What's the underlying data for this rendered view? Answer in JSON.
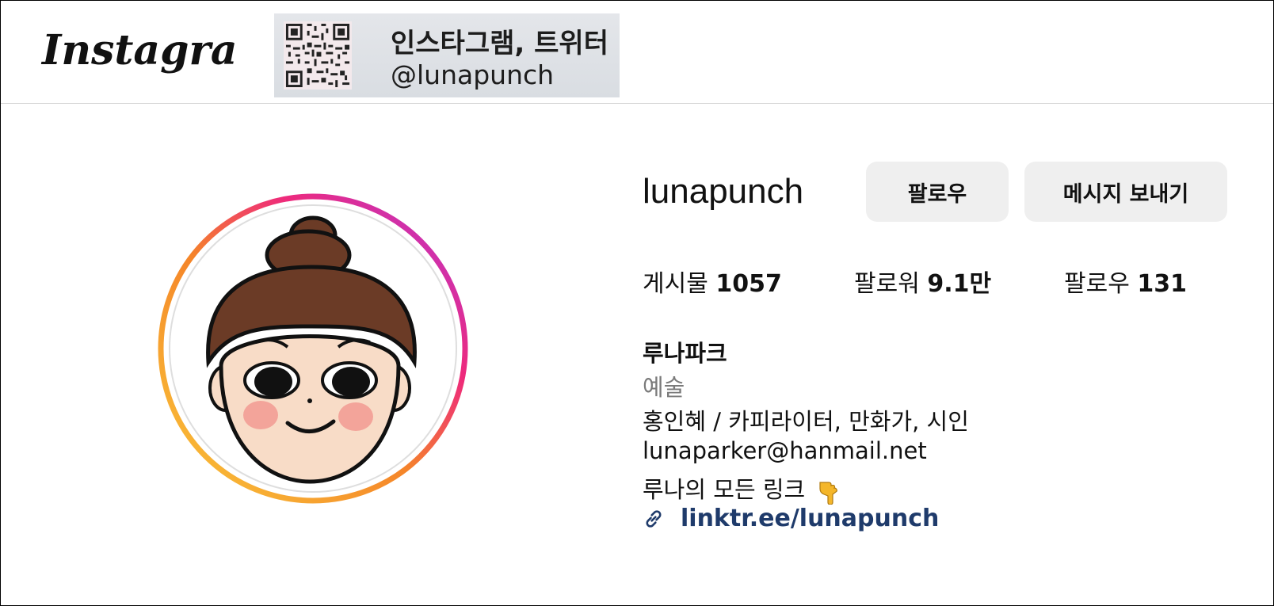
{
  "header": {
    "logo_text": "Instagram",
    "banner_line1": "인스타그램, 트위터",
    "banner_line2": "@lunapunch"
  },
  "profile": {
    "username": "lunapunch",
    "follow_label": "팔로우",
    "message_label": "메시지 보내기",
    "stats": {
      "posts_label": "게시물",
      "posts_value": "1057",
      "followers_label": "팔로워",
      "followers_value": "9.1만",
      "following_label": "팔로우",
      "following_value": "131"
    },
    "bio": {
      "name": "루나파크",
      "category": "예술",
      "line1": "홍인혜 / 카피라이터, 만화가, 시인",
      "line2": "lunaparker@hanmail.net",
      "line3": "루나의 모든 링크",
      "link": "linktr.ee/lunapunch"
    }
  },
  "icons": {
    "link": "link-icon",
    "hand": "pointing-down-hand-icon",
    "qr": "qr-code-icon"
  },
  "colors": {
    "story_ring_start": "#f9c83a",
    "story_ring_mid": "#ee2a7b",
    "story_ring_end": "#b436d6",
    "button_bg": "#efefef",
    "link": "#1f3b6b",
    "category": "#7a7a7a"
  }
}
